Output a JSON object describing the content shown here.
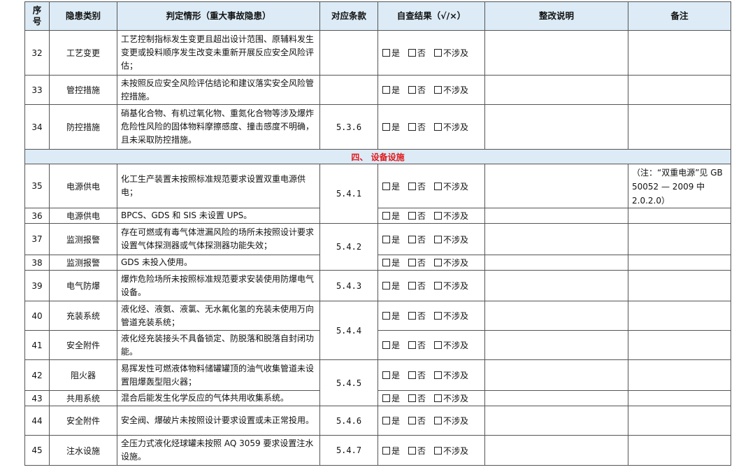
{
  "header": {
    "no": "序号",
    "category": "隐患类别",
    "criteria": "判定情形（重大事故隐患）",
    "clause": "对应条款",
    "result": "自查结果（√/×）",
    "rectify": "整改说明",
    "remark": "备注"
  },
  "options": {
    "yes": "是",
    "no": "否",
    "na": "不涉及"
  },
  "rows": [
    {
      "no": "32",
      "category": "工艺变更",
      "criteria": "工艺控制指标发生变更且超出设计范围、原辅料发生变更或投料顺序发生改变未重新开展反应安全风险评估；"
    },
    {
      "no": "33",
      "category": "管控措施",
      "criteria": "未按照反应安全风险评估结论和建议落实安全风险管控措施。"
    },
    {
      "no": "34",
      "category": "防控措施",
      "criteria": "硝基化合物、有机过氧化物、重氮化合物等涉及爆炸危险性风险的固体物料摩擦感度、撞击感度不明确，且未采取防控措施。",
      "clause": "5.3.6"
    },
    {
      "no": "35",
      "category": "电源供电",
      "criteria": "化工生产装置未按照标准规范要求设置双重电源供电；",
      "clause": "5.4.1",
      "remark": "（注：“双重电源”见 GB 50052 — 2009 中 2.0.2.0）"
    },
    {
      "no": "36",
      "category": "电源供电",
      "criteria": "BPCS、GDS 和 SIS 未设置 UPS。"
    },
    {
      "no": "37",
      "category": "监测报警",
      "criteria": "存在可燃或有毒气体泄漏风险的场所未按照设计要求设置气体探测器或气体探测器功能失效；",
      "clause": "5.4.2"
    },
    {
      "no": "38",
      "category": "监测报警",
      "criteria": "GDS 未投入使用。"
    },
    {
      "no": "39",
      "category": "电气防爆",
      "criteria": "爆炸危险场所未按照标准规范要求安装使用防爆电气设备。",
      "clause": "5.4.3"
    },
    {
      "no": "40",
      "category": "充装系统",
      "criteria": "液化烃、液氨、液氯、无水氟化氢的充装未使用万向管道充装系统；",
      "clause": "5.4.4"
    },
    {
      "no": "41",
      "category": "安全附件",
      "criteria": "液化烃充装接头不具备锁定、防脱落和脱落自封闭功能。"
    },
    {
      "no": "42",
      "category": "阻火器",
      "criteria": "易挥发性可燃液体物料储罐罐顶的油气收集管道未设置阻爆轰型阻火器；",
      "clause": "5.4.5"
    },
    {
      "no": "43",
      "category": "共用系统",
      "criteria": "混合后能发生化学反应的气体共用收集系统。"
    },
    {
      "no": "44",
      "category": "安全附件",
      "criteria": "安全阀、爆破片未按照设计要求设置或未正常投用。",
      "clause": "5.4.6"
    },
    {
      "no": "45",
      "category": "注水设施",
      "criteria": "全压力式液化烃球罐未按照 AQ 3059 要求设置注水设施。",
      "clause": "5.4.7"
    }
  ],
  "section": {
    "label": "四、 设备设施"
  }
}
